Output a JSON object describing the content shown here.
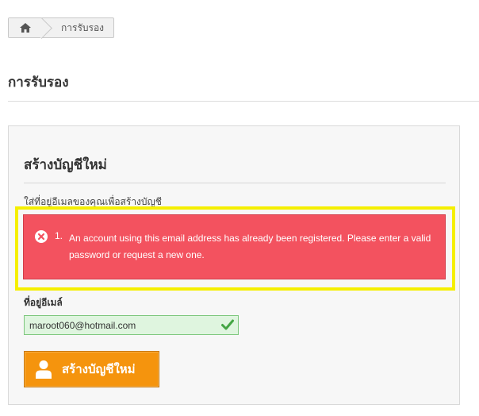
{
  "breadcrumb": {
    "home_icon": "home-icon",
    "current": "การรับรอง"
  },
  "page": {
    "title": "การรับรอง"
  },
  "panel": {
    "title": "สร้างบัญชีใหม่",
    "intro": "ใส่ที่อยู่อีเมลของคุณเพื่อสร้างบัญชี"
  },
  "alert": {
    "icon": "error-circle-icon",
    "number": "1.",
    "message": "An account using this email address has already been registered. Please enter a valid password or request a new one.",
    "color": "#f3525f"
  },
  "form": {
    "email_label": "ที่อยู่อีเมล์",
    "email_value": "maroot060@hotmail.com",
    "valid_icon": "check-icon",
    "valid_color": "#44a544",
    "submit_label": "สร้างบัญชีใหม่",
    "submit_icon": "user-icon",
    "submit_color": "#f5940d"
  },
  "annotation": {
    "highlight_color": "#f5ef00"
  }
}
